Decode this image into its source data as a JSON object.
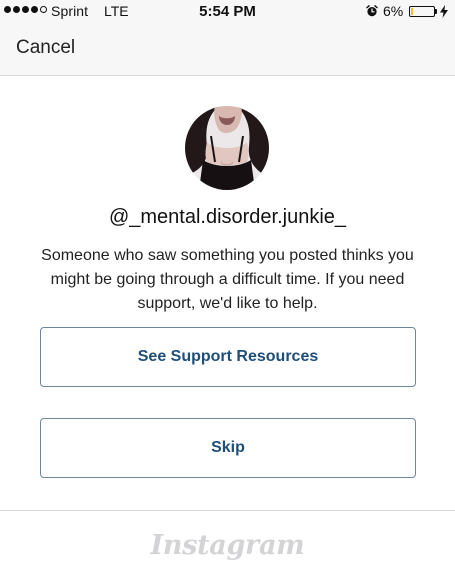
{
  "status_bar": {
    "carrier": "Sprint",
    "network": "LTE",
    "time": "5:54 PM",
    "battery_percent_label": "6%",
    "battery_level": 0.06,
    "signal_bars_filled": 4,
    "signal_bars_total": 5,
    "icons": [
      "alarm-icon",
      "charging-bolt-icon"
    ]
  },
  "nav": {
    "cancel_label": "Cancel"
  },
  "profile": {
    "username": "@_mental.disorder.junkie_"
  },
  "message": "Someone who saw something you posted thinks you might be going through a difficult time. If you need support, we'd like to help.",
  "buttons": {
    "support_label": "See Support Resources",
    "skip_label": "Skip"
  },
  "footer": {
    "logo_text": "Instagram"
  },
  "colors": {
    "button_text": "#1f4e79",
    "button_border": "#6f869c",
    "bar_background": "#f7f7f8",
    "logo": "#d4d4d6"
  }
}
